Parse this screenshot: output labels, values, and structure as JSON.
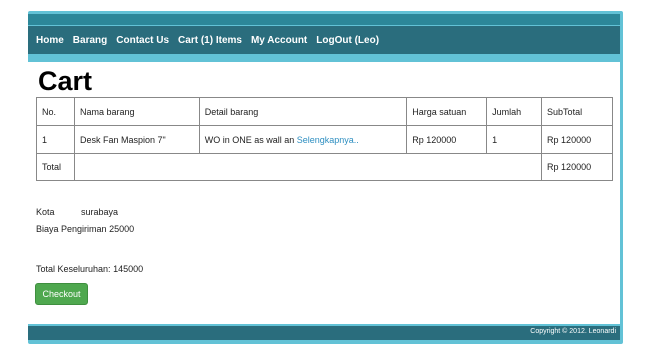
{
  "nav": {
    "items": [
      "Home",
      "Barang",
      "Contact Us",
      "Cart (1) Items",
      "My Account",
      "LogOut (Leo)"
    ]
  },
  "page": {
    "title": "Cart"
  },
  "cart": {
    "headers": [
      "No.",
      "Nama barang",
      "Detail barang",
      "Harga satuan",
      "Jumlah",
      "SubTotal"
    ],
    "rows": [
      {
        "no": "1",
        "name": "Desk Fan Maspion 7\"",
        "detail": "WO in ONE as wall an",
        "detail_link": "Selengkapnya..",
        "price": "Rp 120000",
        "qty": "1",
        "subtotal": "Rp 120000"
      }
    ],
    "total_label": "Total",
    "total_value": "Rp 120000"
  },
  "shipping": {
    "city_label": "Kota",
    "city_value": "surabaya",
    "cost_label": "Biaya Pengiriman",
    "cost_value": "25000"
  },
  "summary": {
    "grand_total_label": "Total Keseluruhan:",
    "grand_total_value": "145000"
  },
  "checkout_label": "Checkout",
  "footer": {
    "copyright": "Copyright © 2012. Leonardi"
  },
  "colors": {
    "frame": "#62c2d6",
    "nav_bg": "#2a6d7d",
    "link": "#2f8fc1",
    "checkout_bg": "#4fa84f"
  }
}
